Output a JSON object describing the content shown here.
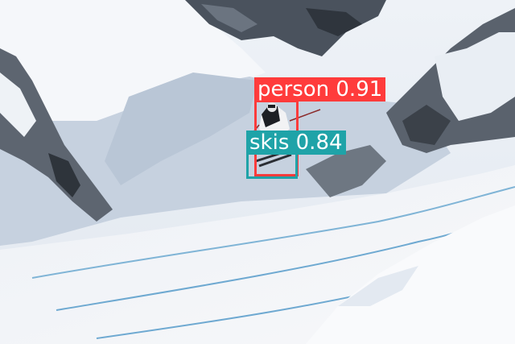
{
  "image": {
    "description_colors": {
      "snow": "#f2f5f9",
      "shadow": "#c3cfdd",
      "rock": "#3f4650"
    }
  },
  "detections": [
    {
      "id": "person",
      "label": "person",
      "score": "0.91",
      "color": "#ff3b3b"
    },
    {
      "id": "skis",
      "label": "skis",
      "score": "0.84",
      "color": "#1fa3a8"
    }
  ]
}
